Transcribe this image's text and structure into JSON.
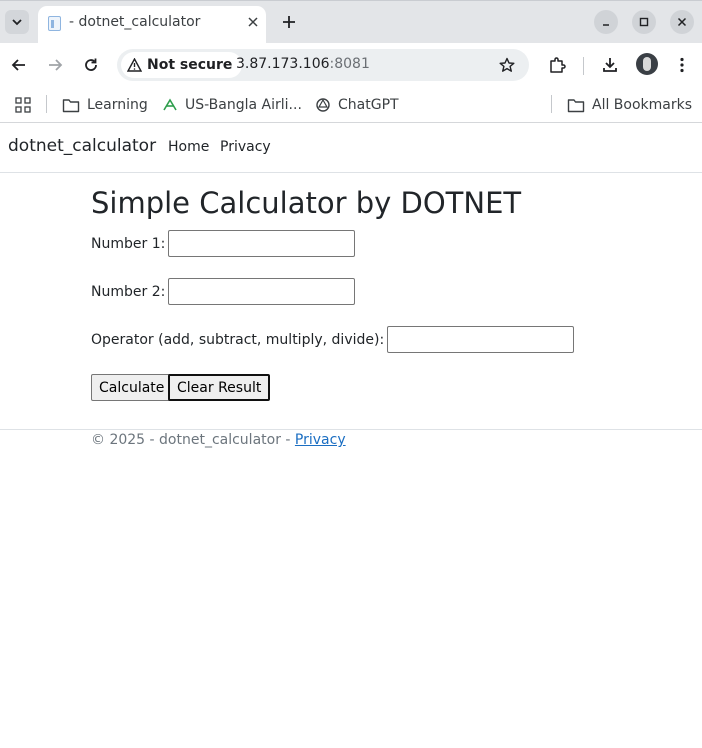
{
  "browser": {
    "tab": {
      "title": "- dotnet_calculator"
    },
    "address_bar": {
      "security_label": "Not secure",
      "host": "3.87.173.106",
      "port": ":8081"
    },
    "bookmarks": [
      {
        "label": "Learning",
        "icon": "folder-icon"
      },
      {
        "label": "US-Bangla Airli...",
        "icon": "airline-logo-icon"
      },
      {
        "label": "ChatGPT",
        "icon": "chatgpt-icon"
      }
    ],
    "all_bookmarks_label": "All Bookmarks"
  },
  "site": {
    "brand": "dotnet_calculator",
    "nav": [
      {
        "label": "Home"
      },
      {
        "label": "Privacy"
      }
    ]
  },
  "calculator": {
    "title": "Simple Calculator by DOTNET",
    "fields": [
      {
        "label": "Number 1:",
        "value": ""
      },
      {
        "label": "Number 2:",
        "value": ""
      },
      {
        "label": "Operator (add, subtract, multiply, divide):",
        "value": ""
      }
    ],
    "buttons": {
      "calculate": "Calculate",
      "clear": "Clear Result"
    }
  },
  "footer": {
    "text": "© 2025 - dotnet_calculator - ",
    "link": "Privacy"
  },
  "colors": {
    "link": "#1b6ec2",
    "text": "#212529",
    "muted": "#6c757d"
  }
}
